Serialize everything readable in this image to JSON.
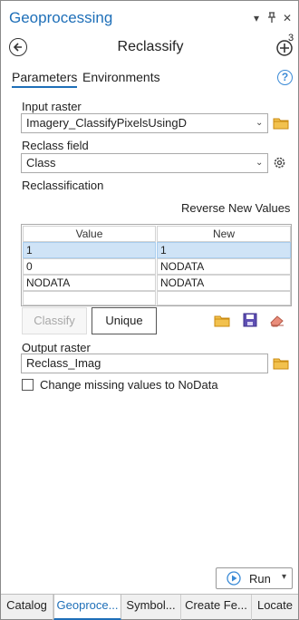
{
  "pane": {
    "title": "Geoprocessing",
    "menu_icon": "chevron-down-icon",
    "pin_icon": "pin-icon",
    "close_icon": "close-icon"
  },
  "tool": {
    "name": "Reclassify",
    "back_icon": "back-arrow-icon",
    "add_icon": "add-icon",
    "add_badge": "3"
  },
  "tabs": {
    "parameters": "Parameters",
    "environments": "Environments",
    "help": "?"
  },
  "input_raster": {
    "label": "Input raster",
    "value": "Imagery_ClassifyPixelsUsingD"
  },
  "reclass_field": {
    "label": "Reclass field",
    "value": "Class"
  },
  "reclassification": {
    "label": "Reclassification",
    "reverse_label": "Reverse New Values",
    "columns": [
      "Value",
      "New"
    ],
    "rows": [
      [
        "1",
        "1"
      ],
      [
        "0",
        "NODATA"
      ],
      [
        "NODATA",
        "NODATA"
      ],
      [
        "",
        ""
      ]
    ],
    "selected_row": 0
  },
  "buttons": {
    "classify": "Classify",
    "unique": "Unique"
  },
  "output_raster": {
    "label": "Output raster",
    "value": "Reclass_Imag"
  },
  "missing_nodata": {
    "label": "Change missing values to NoData",
    "checked": false
  },
  "run": {
    "label": "Run"
  },
  "bottom_tabs": [
    "Catalog",
    "Geoproce...",
    "Symbol...",
    "Create Fe...",
    "Locate"
  ],
  "active_bottom_tab": 1,
  "colors": {
    "accent": "#1e6fb8",
    "folder": "#e8a72a",
    "selection": "#cfe3f6"
  }
}
